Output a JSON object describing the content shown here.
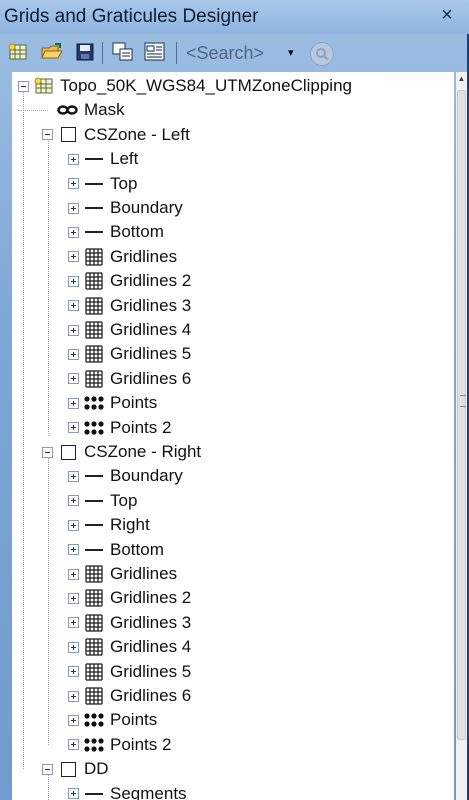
{
  "window": {
    "title": "Grids and Graticules Designer",
    "close_glyph": "×"
  },
  "toolbar": {
    "buttons": [
      {
        "name": "new-icon"
      },
      {
        "name": "open-folder-icon"
      },
      {
        "name": "save-icon"
      },
      {
        "name": "copy-icon"
      },
      {
        "name": "properties-icon"
      }
    ],
    "search_placeholder": "<Search>",
    "dropdown_glyph": "▾"
  },
  "tree": {
    "root": {
      "label": "Topo_50K_WGS84_UTMZoneClipping",
      "icon": "grid-table-icon"
    },
    "items": [
      {
        "label": "Mask",
        "icon": "mask-icon",
        "level": 1,
        "expander": "none"
      },
      {
        "label": "CSZone - Left",
        "icon": "square-icon",
        "level": 1,
        "expander": "minus"
      },
      {
        "label": "Left",
        "icon": "line-icon",
        "level": 2,
        "expander": "plus"
      },
      {
        "label": "Top",
        "icon": "line-icon",
        "level": 2,
        "expander": "plus"
      },
      {
        "label": "Boundary",
        "icon": "line-icon",
        "level": 2,
        "expander": "plus"
      },
      {
        "label": "Bottom",
        "icon": "line-icon",
        "level": 2,
        "expander": "plus"
      },
      {
        "label": "Gridlines",
        "icon": "gridlines-icon",
        "level": 2,
        "expander": "plus"
      },
      {
        "label": "Gridlines 2",
        "icon": "gridlines-icon",
        "level": 2,
        "expander": "plus"
      },
      {
        "label": "Gridlines 3",
        "icon": "gridlines-icon",
        "level": 2,
        "expander": "plus"
      },
      {
        "label": "Gridlines 4",
        "icon": "gridlines-icon",
        "level": 2,
        "expander": "plus"
      },
      {
        "label": "Gridlines 5",
        "icon": "gridlines-icon",
        "level": 2,
        "expander": "plus"
      },
      {
        "label": "Gridlines 6",
        "icon": "gridlines-icon",
        "level": 2,
        "expander": "plus"
      },
      {
        "label": "Points",
        "icon": "points-icon",
        "level": 2,
        "expander": "plus"
      },
      {
        "label": "Points 2",
        "icon": "points-icon",
        "level": 2,
        "expander": "plus"
      },
      {
        "label": "CSZone - Right",
        "icon": "square-icon",
        "level": 1,
        "expander": "minus"
      },
      {
        "label": "Boundary",
        "icon": "line-icon",
        "level": 2,
        "expander": "plus"
      },
      {
        "label": "Top",
        "icon": "line-icon",
        "level": 2,
        "expander": "plus"
      },
      {
        "label": "Right",
        "icon": "line-icon",
        "level": 2,
        "expander": "plus"
      },
      {
        "label": "Bottom",
        "icon": "line-icon",
        "level": 2,
        "expander": "plus"
      },
      {
        "label": "Gridlines",
        "icon": "gridlines-icon",
        "level": 2,
        "expander": "plus"
      },
      {
        "label": "Gridlines 2",
        "icon": "gridlines-icon",
        "level": 2,
        "expander": "plus"
      },
      {
        "label": "Gridlines 3",
        "icon": "gridlines-icon",
        "level": 2,
        "expander": "plus"
      },
      {
        "label": "Gridlines 4",
        "icon": "gridlines-icon",
        "level": 2,
        "expander": "plus"
      },
      {
        "label": "Gridlines 5",
        "icon": "gridlines-icon",
        "level": 2,
        "expander": "plus"
      },
      {
        "label": "Gridlines 6",
        "icon": "gridlines-icon",
        "level": 2,
        "expander": "plus"
      },
      {
        "label": "Points",
        "icon": "points-icon",
        "level": 2,
        "expander": "plus"
      },
      {
        "label": "Points 2",
        "icon": "points-icon",
        "level": 2,
        "expander": "plus"
      },
      {
        "label": "DD",
        "icon": "square-icon",
        "level": 1,
        "expander": "minus"
      },
      {
        "label": "Segments",
        "icon": "line-icon",
        "level": 2,
        "expander": "plus"
      }
    ]
  },
  "colors": {
    "frame": "#7ea6d6",
    "panel": "#ffffff"
  }
}
